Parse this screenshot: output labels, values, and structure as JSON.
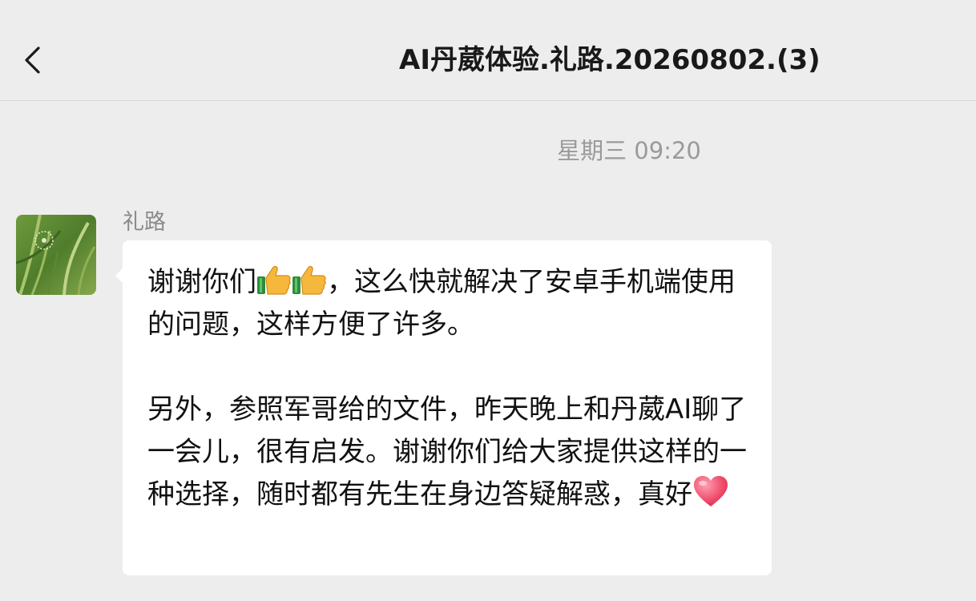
{
  "header": {
    "title": "AI丹葳体验.礼路.20260802.(3)",
    "back_icon": "chevron-left-icon"
  },
  "chat": {
    "timestamp": "星期三 09:20",
    "message": {
      "sender": "礼路",
      "avatar_icon": "dandelion-grass-photo",
      "paragraph1": {
        "before_emoji": "谢谢你们",
        "emojis": [
          "thumbs-up-icon",
          "thumbs-up-icon"
        ],
        "after_emoji": "，这么快就解决了安卓手机端使用的问题，这样方便了许多。"
      },
      "paragraph2": {
        "text": "另外，参照军哥给的文件，昨天晚上和丹葳AI聊了一会儿，很有启发。谢谢你们给大家提供这样的一种选择，随时都有先生在身边答疑解惑，真好",
        "trailing_emoji": "red-heart-icon"
      }
    }
  },
  "colors": {
    "background": "#ededed",
    "bubble": "#ffffff",
    "title": "#191919",
    "timestamp": "#9a9a9a",
    "sender": "#8a8a8a"
  }
}
